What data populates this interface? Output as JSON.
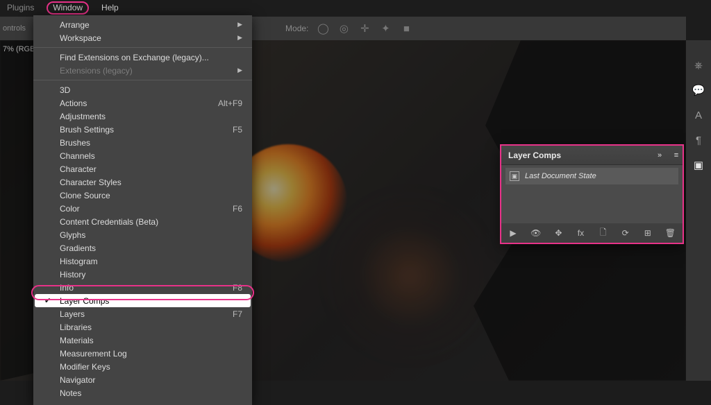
{
  "menubar": {
    "plugins": "Plugins",
    "window": "Window",
    "help": "Help"
  },
  "optbar": {
    "controls": "ontrols",
    "mode": "Mode:"
  },
  "docstatus": "7% (RGB",
  "window_menu": {
    "arrange": "Arrange",
    "workspace": "Workspace",
    "find_ext": "Find Extensions on Exchange (legacy)...",
    "extensions": "Extensions (legacy)",
    "three_d": "3D",
    "actions": "Actions",
    "actions_sc": "Alt+F9",
    "adjustments": "Adjustments",
    "brush_settings": "Brush Settings",
    "brush_settings_sc": "F5",
    "brushes": "Brushes",
    "channels": "Channels",
    "character": "Character",
    "character_styles": "Character Styles",
    "clone_source": "Clone Source",
    "color": "Color",
    "color_sc": "F6",
    "content_cred": "Content Credentials (Beta)",
    "glyphs": "Glyphs",
    "gradients": "Gradients",
    "histogram": "Histogram",
    "history": "History",
    "info": "Info",
    "info_sc": "F8",
    "layer_comps": "Layer Comps",
    "layers": "Layers",
    "layers_sc": "F7",
    "libraries": "Libraries",
    "materials": "Materials",
    "measurement_log": "Measurement Log",
    "modifier_keys": "Modifier Keys",
    "navigator": "Navigator",
    "notes": "Notes"
  },
  "panel": {
    "title": "Layer Comps",
    "last_state": "Last Document State"
  }
}
